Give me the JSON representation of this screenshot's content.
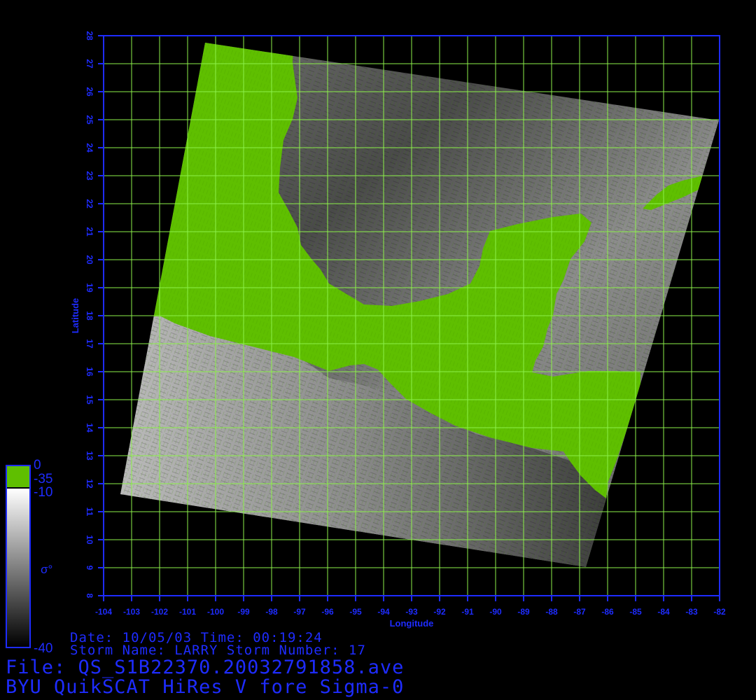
{
  "axes": {
    "xlabel": "Longitude",
    "ylabel": "Latitude",
    "lon_ticks": [
      "-104",
      "-103",
      "-102",
      "-101",
      "-100",
      "-99",
      "-98",
      "-97",
      "-96",
      "-95",
      "-94",
      "-93",
      "-92",
      "-91",
      "-90",
      "-89",
      "-88",
      "-87",
      "-86",
      "-85",
      "-84",
      "-83",
      "-82"
    ],
    "lat_ticks": [
      "8",
      "9",
      "10",
      "11",
      "12",
      "13",
      "14",
      "15",
      "16",
      "17",
      "18",
      "19",
      "20",
      "21",
      "22",
      "23",
      "24",
      "25",
      "26",
      "27",
      "28"
    ],
    "lon_range": [
      -104,
      -82
    ],
    "lat_range": [
      8,
      28
    ],
    "grid": true
  },
  "colorbar": {
    "symbol": "σ°",
    "labels": [
      "0",
      "-35",
      "-10",
      "-40"
    ],
    "land_color": "#5fbf00",
    "ocean_scale": "grayscale"
  },
  "info": {
    "line1": "Date: 10/05/03  Time: 00:19:24",
    "line2": "Storm Name: LARRY  Storm Number: 17"
  },
  "file_line": "File: QS_S1B22370.20032791858.ave",
  "product_line": "BYU QuikSCAT HiRes V fore Sigma-0",
  "colors": {
    "background": "#000000",
    "text": "#1e2cff",
    "grid": "#8cf04a",
    "frame": "#1e2cff",
    "land": "#5fbf00"
  }
}
